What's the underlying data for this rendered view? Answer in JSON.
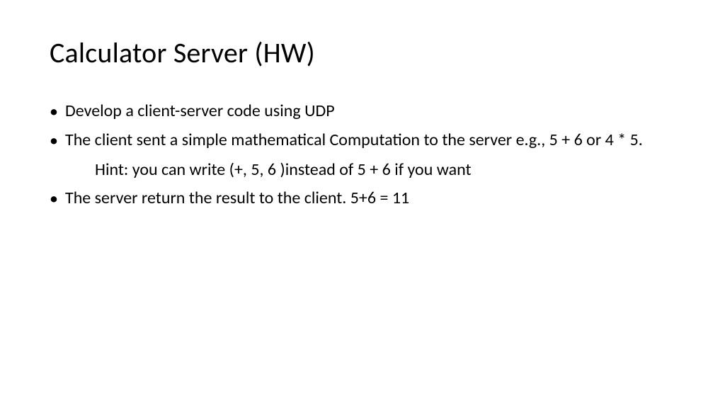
{
  "slide": {
    "title": "Calculator Server (HW)",
    "bullet1": "Develop a client-server code using UDP",
    "bullet2": "The client sent a simple mathematical Computation to the server e.g., 5 + 6  or 4 * 5.",
    "hint": "Hint: you can write (+, 5, 6 )instead of 5 + 6 if you want",
    "bullet3": "The server return the result to the client. 5+6 = 11"
  }
}
